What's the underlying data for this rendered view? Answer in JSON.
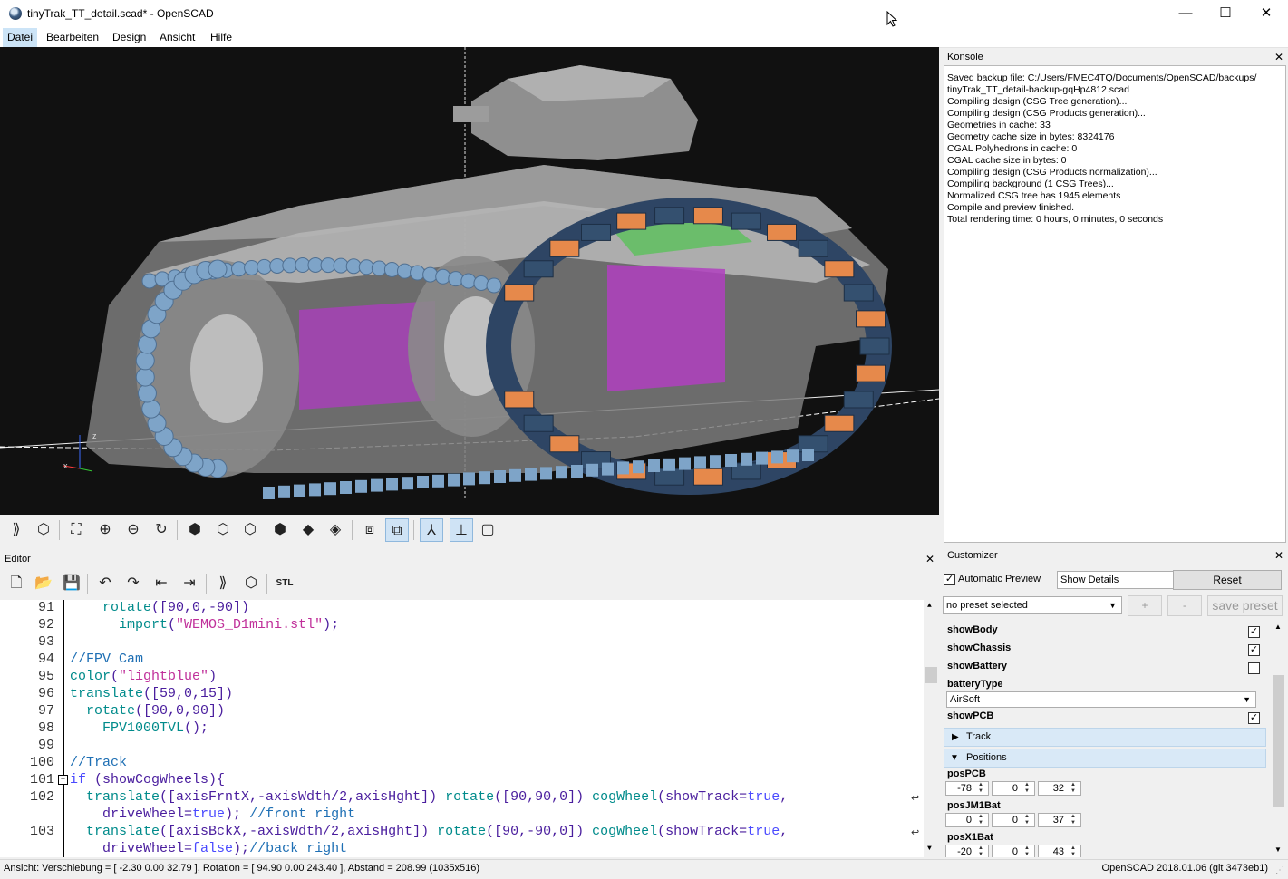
{
  "window": {
    "title": "tinyTrak_TT_detail.scad* - OpenSCAD",
    "minimize": "—",
    "maximize": "☐",
    "close": "✕"
  },
  "menu": [
    "Datei",
    "Bearbeiten",
    "Design",
    "Ansicht",
    "Hilfe"
  ],
  "console": {
    "header": "Konsole",
    "lines": [
      "Saved backup file: C:/Users/FMEC4TQ/Documents/OpenSCAD/backups/",
      "tinyTrak_TT_detail-backup-gqHp4812.scad",
      "Compiling design (CSG Tree generation)...",
      "Compiling design (CSG Products generation)...",
      "Geometries in cache: 33",
      "Geometry cache size in bytes: 8324176",
      "CGAL Polyhedrons in cache: 0",
      "CGAL cache size in bytes: 0",
      "Compiling design (CSG Products normalization)...",
      "Compiling background (1 CSG Trees)...",
      "Normalized CSG tree has 1945 elements",
      "Compile and preview finished.",
      "Total rendering time: 0 hours, 0 minutes, 0 seconds"
    ]
  },
  "editor": {
    "header": "Editor",
    "toolbar_icons": [
      "new-file-icon",
      "open-file-icon",
      "save-icon",
      "undo-icon",
      "redo-icon",
      "unindent-icon",
      "indent-icon",
      "preview-icon",
      "render-icon",
      "export-stl-icon"
    ],
    "stl_label": "STL",
    "line_numbers": [
      "91",
      "92",
      "93",
      "94",
      "95",
      "96",
      "97",
      "98",
      "99",
      "100",
      "101",
      "102",
      "",
      "103",
      ""
    ],
    "code_lines": [
      "    rotate([90,0,-90])",
      "      import(\"WEMOS_D1mini.stl\");",
      "",
      "//FPV Cam",
      "color(\"lightblue\")",
      "translate([59,0,15])",
      "  rotate([90,0,90])",
      "    FPV1000TVL();",
      "",
      "//Track",
      "if (showCogWheels){",
      "  translate([axisFrntX,-axisWdth/2,axisHght]) rotate([90,90,0]) cogWheel(showTrack=true,",
      "    driveWheel=true); //front right",
      "  translate([axisBckX,-axisWdth/2,axisHght]) rotate([90,-90,0]) cogWheel(showTrack=true,",
      "    driveWheel=false);//back right"
    ]
  },
  "customizer": {
    "header": "Customizer",
    "automatic_preview_label": "Automatic Preview",
    "automatic_preview_checked": true,
    "details_combo": "Show Details",
    "reset_label": "Reset",
    "preset_combo": "no preset selected",
    "add_preset": "+",
    "remove_preset": "-",
    "save_preset": "save preset",
    "params": [
      {
        "name": "showBody",
        "checked": true
      },
      {
        "name": "showChassis",
        "checked": true
      },
      {
        "name": "showBattery",
        "checked": false
      }
    ],
    "battery_type_label": "batteryType",
    "battery_type_value": "AirSoft",
    "show_pcb_label": "showPCB",
    "show_pcb_checked": true,
    "groups": {
      "track": "Track",
      "positions": "Positions"
    },
    "positions": [
      {
        "name": "posPCB",
        "values": [
          "-78",
          "0",
          "32"
        ]
      },
      {
        "name": "posJM1Bat",
        "values": [
          "0",
          "0",
          "37"
        ]
      },
      {
        "name": "posX1Bat",
        "values": [
          "-20",
          "0",
          "43"
        ]
      }
    ]
  },
  "viewer_toolbar_icons": [
    "preview-icon",
    "render-icon",
    "view-all-icon",
    "zoom-in-icon",
    "zoom-out-icon",
    "reset-view-icon",
    "view-right-icon",
    "view-top-icon",
    "view-bottom-icon",
    "view-left-icon",
    "view-front-icon",
    "view-back-icon",
    "perspective-icon",
    "orthogonal-icon",
    "show-axes-icon",
    "show-scale-markers-icon",
    "show-edges-icon"
  ],
  "status": {
    "left": "Ansicht: Verschiebung = [ -2.30 0.00 32.79 ], Rotation = [ 94.90 0.00 243.40 ], Abstand = 208.99 (1035x516)",
    "right": "OpenSCAD 2018.01.06 (git 3473eb1)"
  },
  "colors": {
    "viewport_bg": "#111111",
    "track_blue": "#7ea4c8",
    "track_orange": "#e6894b",
    "body_grey": "#a8a8a8",
    "battery_magenta": "#b040c0",
    "pcb_green": "#5fbf5f",
    "selection_blue": "#d9e9f7"
  }
}
